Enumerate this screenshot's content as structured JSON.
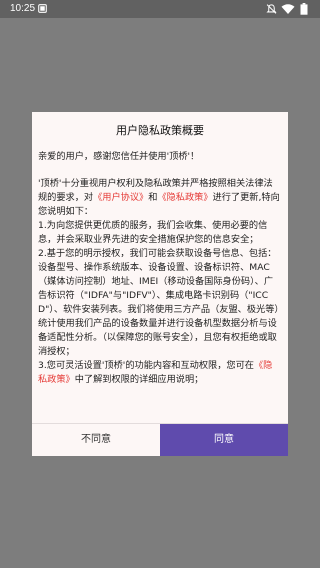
{
  "status_bar": {
    "time": "10:25",
    "icons": [
      "notification-box-icon",
      "mute-bell-icon",
      "wifi-icon",
      "battery-icon"
    ]
  },
  "dialog": {
    "title": "用户隐私政策概要",
    "greeting": "亲爱的用户，感谢您信任并使用'顶桥'！",
    "intro_before_link1": "'顶桥'十分重视用户权利及隐私政策并严格按照相关法律法规的要求，对",
    "link_user_agreement": "《用户协议》",
    "and": "和",
    "link_privacy_policy": "《隐私政策》",
    "intro_after_links": "进行了更新,特向您说明如下：",
    "item1": "1.为向您提供更优质的服务，我们会收集、使用必要的信息，并会采取业界先进的安全措施保护您的信息安全；",
    "item2": "2.基于您的明示授权，我们可能会获取设备号信息、包括：设备型号、操作系统版本、设备设置、设备标识符、MAC（媒体访问控制）地址、IMEI（移动设备国际身份码）、广告标识符（\"IDFA\"与\"IDFV\"）、集成电路卡识别码（\"ICCD\"）、软件安装列表。我们将使用三方产品（友盟、极光等）统计使用我们产品的设备数量并进行设备机型数据分析与设备适配性分析。（以保障您的账号安全），且您有权拒绝或取消授权；",
    "item3_before_link": "3.您可灵活设置'顶桥'的功能内容和互动权限，您可在",
    "item3_link": "《隐私政策》",
    "item3_after_link": "中了解到权限的详细应用说明；",
    "disagree_button": "不同意",
    "agree_button": "同意"
  },
  "colors": {
    "accent": "#5f4bad",
    "link": "#e53935",
    "overlay": "#7d7d7d",
    "dialog_bg": "#fdf7f6"
  }
}
